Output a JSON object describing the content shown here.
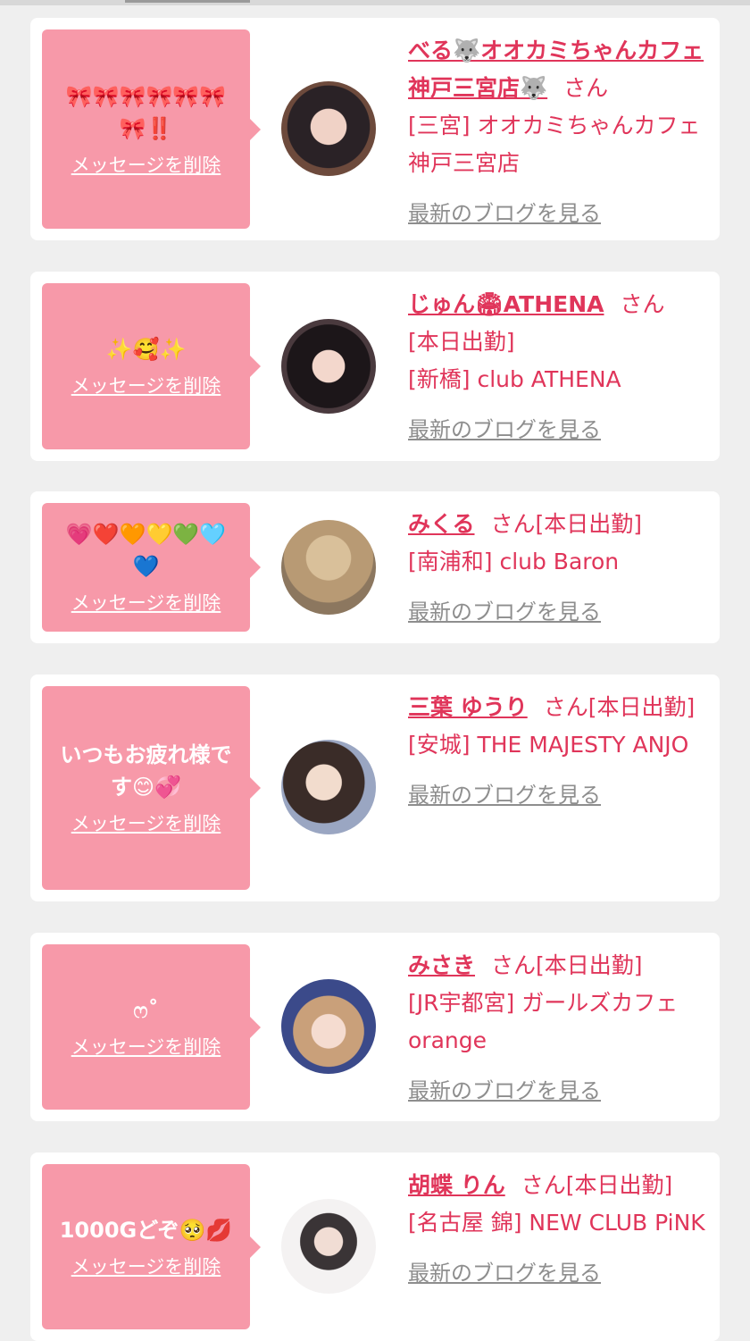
{
  "delete_label": "メッセージを削除",
  "blog_label": "最新のブログを見る",
  "san_label": "さん",
  "cards": [
    {
      "message": "🎀🎀🎀🎀🎀🎀🎀‼️",
      "name": "べる🐺オオカミちゃんカフェ神戸三宮店🐺",
      "status": "",
      "shop": "[三宮] オオカミちゃんカフェ神戸三宮店"
    },
    {
      "message": "✨🥰✨",
      "name": "じゅん🏟ATHENA",
      "status": "[本日出勤]",
      "shop": "[新橋] club ATHENA"
    },
    {
      "message": "💗❤️🧡💛💚🩵💙",
      "name": "みくる",
      "status": "[本日出勤]",
      "shop": "[南浦和] club Baron"
    },
    {
      "message": "いつもお疲れ様です😊💞",
      "name": "三葉 ゆうり",
      "status": "[本日出勤]",
      "shop": "[安城] THE MAJESTY ANJO"
    },
    {
      "message": "ෆ˚",
      "name": "みさき",
      "status": "[本日出勤]",
      "shop": "[JR宇都宮] ガールズカフェ orange"
    },
    {
      "message": "1000Gどぞ🥺💋",
      "name": "胡蝶 りん",
      "status": "[本日出勤]",
      "shop": "[名古屋 錦] NEW CLUB PiNK"
    }
  ]
}
